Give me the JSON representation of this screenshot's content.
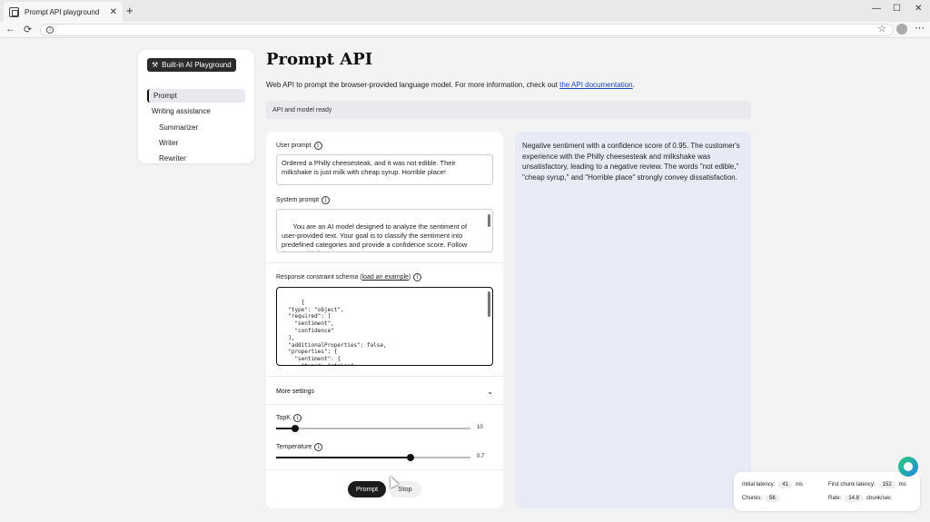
{
  "browser": {
    "tab_title": "Prompt API playground",
    "tab_close": "✕",
    "new_tab": "+",
    "win_min": "—",
    "win_max": "☐",
    "win_close": "✕",
    "back": "←",
    "reload": "⟳",
    "star": "☆",
    "more": "⋯"
  },
  "sidebar": {
    "brand": "Built-in AI Playground",
    "items": [
      {
        "label": "Prompt",
        "active": true
      },
      {
        "label": "Writing assistance"
      },
      {
        "label": "Summarizer"
      },
      {
        "label": "Writer"
      },
      {
        "label": "Rewriter"
      }
    ]
  },
  "main": {
    "title": "Prompt API",
    "description": "Web API to prompt the browser-provided language model. For more information, check out ",
    "doc_link": "the API documentation",
    "description_end": ".",
    "status": "API and model ready"
  },
  "form": {
    "user_prompt_label": "User prompt",
    "user_prompt_value": "Ordered a Philly cheesesteak, and it was not edible. Their milkshake is just milk with cheap syrup. Horrible place!",
    "system_prompt_label": "System prompt",
    "system_prompt_value": "You are an AI model designed to analyze the sentiment of user-provided text. Your goal is to classify the sentiment into predefined categories and provide a confidence score. Follow these guidelines:\n\n- Identify whether the sentiment is positive, negative, or neutral.",
    "schema_label": "Response constraint schema (",
    "schema_link": "load an example",
    "schema_label_end": ")",
    "schema_value": "{\n  \"type\": \"object\",\n  \"required\": [\n    \"sentiment\",\n    \"confidence\"\n  ],\n  \"additionalProperties\": false,\n  \"properties\": {\n    \"sentiment\": {\n      \"type\": \"string\",\n      \"enum\": [",
    "more_settings": "More settings",
    "topk_label": "TopK",
    "topk_value": "10",
    "topk_fraction": 0.1,
    "temperature_label": "Temperature",
    "temperature_value": "0.7",
    "temperature_fraction": 0.69,
    "prompt_button": "Prompt",
    "stop_button": "Stop"
  },
  "response": "Negative sentiment with a confidence score of 0.95. The customer's experience with the Philly cheesesteak and milkshake was unsatisfactory, leading to a negative review. The words \"not edible,\" \"cheap syrup,\" and \"Horrible place\" strongly convey dissatisfaction.",
  "stats": {
    "initial_latency_label": "Initial latency:",
    "initial_latency_value": "41",
    "initial_latency_unit": "ms",
    "first_chunk_label": "First chunk latency:",
    "first_chunk_value": "152",
    "first_chunk_unit": "ms",
    "chunks_label": "Chunks:",
    "chunks_value": "56",
    "rate_label": "Rate:",
    "rate_value": "14.8",
    "rate_unit": "chunk/sec"
  }
}
